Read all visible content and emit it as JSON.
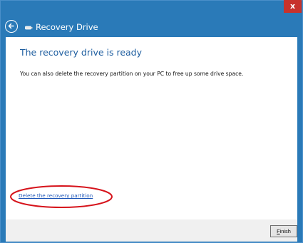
{
  "window": {
    "title": "Recovery Drive",
    "close_label": "x"
  },
  "content": {
    "heading": "The recovery drive is ready",
    "description": "You can also delete the recovery partition on your PC to free up some drive space.",
    "delete_link": "Delete the recovery partition"
  },
  "footer": {
    "finish_first": "F",
    "finish_rest": "inish"
  },
  "colors": {
    "titlebar": "#2a7ab8",
    "close": "#c7322c",
    "heading": "#1d5d9f",
    "link": "#1c55b8",
    "highlight": "#d6131b"
  },
  "icons": {
    "back": "back-arrow-icon",
    "drive": "usb-drive-icon"
  }
}
